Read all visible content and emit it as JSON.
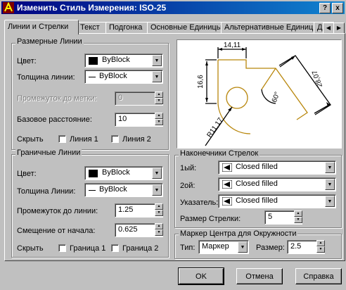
{
  "window": {
    "title": "Изменить Стиль Измерения: ISO-25"
  },
  "title_buttons": {
    "help": "?",
    "close": "x"
  },
  "tabs": [
    "Линии и Стрелки",
    "Текст",
    "Подгонка",
    "Основные Единицы",
    "Альтернативные Единицы",
    "До"
  ],
  "dim_lines": {
    "legend": "Размерные Линии",
    "color_label": "Цвет:",
    "color_value": "ByBlock",
    "lineweight_label": "Толщина линии:",
    "lineweight_value": "ByBlock",
    "extend_ticks_label": "Промежуток до метки:",
    "extend_ticks_value": "0",
    "baseline_spacing_label": "Базовое расстояние:",
    "baseline_spacing_value": "10",
    "suppress_label": "Скрыть",
    "line1_label": "Линия 1",
    "line2_label": "Линия 2"
  },
  "ext_lines": {
    "legend": "Граничные Линии",
    "color_label": "Цвет:",
    "color_value": "ByBlock",
    "lineweight_label": "Толщина Линии:",
    "lineweight_value": "ByBlock",
    "extend_beyond_label": "Промежуток до линии:",
    "extend_beyond_value": "1.25",
    "offset_label": "Смещение от начала:",
    "offset_value": "0.625",
    "suppress_label": "Скрыть",
    "ext1_label": "Граница 1",
    "ext2_label": "Граница 2"
  },
  "preview": {
    "dim_top": "14,11",
    "dim_left": "16,6",
    "dim_right": "28,07",
    "dim_angle": "60°",
    "dim_radius": "R11,17"
  },
  "arrowheads": {
    "legend": "Наконечники Стрелок",
    "first_label": "1ый:",
    "first_value": "Closed filled",
    "second_label": "2ой:",
    "second_value": "Closed filled",
    "leader_label": "Указатель:",
    "leader_value": "Closed filled",
    "size_label": "Размер Стрелки:",
    "size_value": "5"
  },
  "center_marks": {
    "legend": "Маркер Центра для Окружности",
    "type_label": "Тип:",
    "type_value": "Маркер",
    "size_label": "Размер:",
    "size_value": "2.5"
  },
  "buttons": {
    "ok": "OK",
    "cancel": "Отмена",
    "help": "Справка"
  },
  "colors": {
    "preview_geometry": "#b8860b",
    "titlebar": "#000080"
  }
}
